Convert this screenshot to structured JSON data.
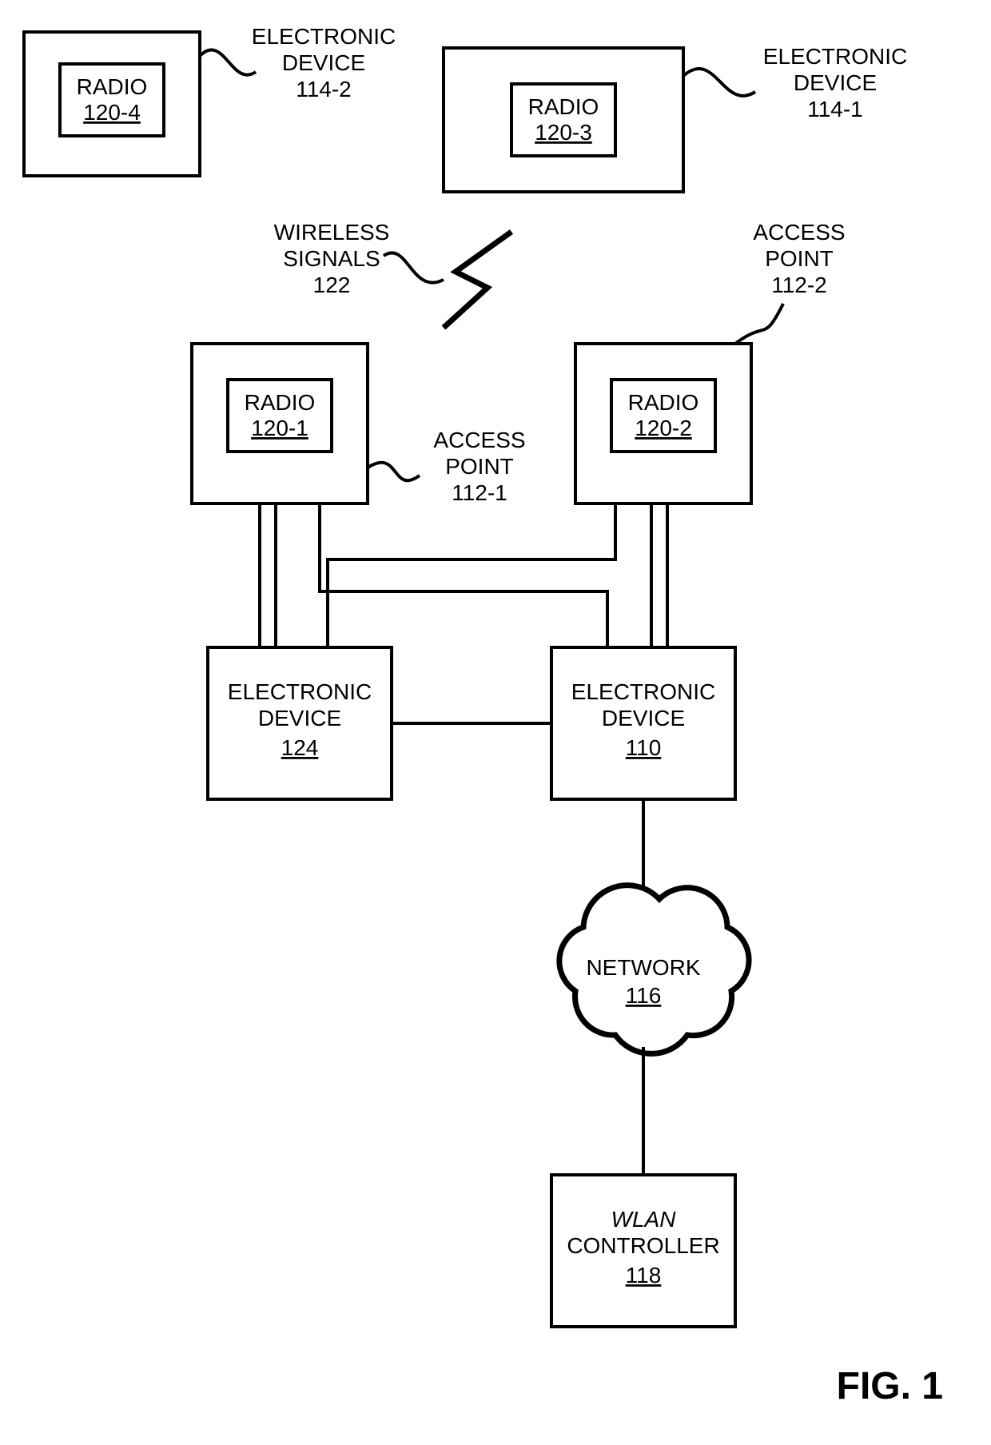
{
  "figure_label": "FIG. 1",
  "wireless_signals": {
    "line1": "WIRELESS",
    "line2": "SIGNALS",
    "ref": "122"
  },
  "electronic_device_114_2": {
    "line1": "ELECTRONIC",
    "line2": "DEVICE",
    "ref": "114-2"
  },
  "electronic_device_114_1": {
    "line1": "ELECTRONIC",
    "line2": "DEVICE",
    "ref": "114-1"
  },
  "access_point_112_1": {
    "line1": "ACCESS",
    "line2": "POINT",
    "ref": "112-1"
  },
  "access_point_112_2": {
    "line1": "ACCESS",
    "line2": "POINT",
    "ref": "112-2"
  },
  "radio_120_1": {
    "label": "RADIO",
    "ref": "120-1"
  },
  "radio_120_2": {
    "label": "RADIO",
    "ref": "120-2"
  },
  "radio_120_3": {
    "label": "RADIO",
    "ref": "120-3"
  },
  "radio_120_4": {
    "label": "RADIO",
    "ref": "120-4"
  },
  "electronic_device_124": {
    "line1": "ELECTRONIC",
    "line2": "DEVICE",
    "ref": "124"
  },
  "electronic_device_110": {
    "line1": "ELECTRONIC",
    "line2": "DEVICE",
    "ref": "110"
  },
  "network": {
    "label": "NETWORK",
    "ref": "116"
  },
  "wlan_controller": {
    "line1": "WLAN",
    "line2": "CONTROLLER",
    "ref": "118"
  }
}
